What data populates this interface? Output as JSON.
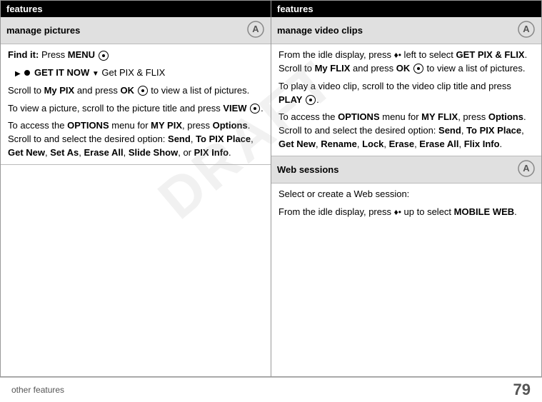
{
  "columns": [
    {
      "header": "features",
      "sections": [
        {
          "title": "manage pictures",
          "hasIcon": true,
          "content": [
            {
              "type": "find-it",
              "text_label": "Find it:",
              "text_main": "Press",
              "bold_key": "MENU",
              "nav_symbol": "(⬤)"
            },
            {
              "type": "get-it-now",
              "arrow": "▶",
              "icon": "◉",
              "bold_text": "GET IT NOW",
              "dropdown": "▼",
              "after": "Get PIX & FLIX"
            },
            {
              "type": "paragraph",
              "text": "Scroll to My PIX and press OK (⬤) to view a list of pictures."
            },
            {
              "type": "paragraph",
              "text": "To view a picture, scroll to the picture title and press VIEW (⬤)."
            },
            {
              "type": "paragraph",
              "text": "To access the OPTIONS menu for MY PIX, press Options. Scroll to and select the desired option: Send, To PIX Place, Get New, Set As, Erase All, Slide Show, or PIX Info."
            }
          ]
        }
      ]
    },
    {
      "header": "features",
      "sections": [
        {
          "title": "manage video clips",
          "hasIcon": true,
          "content": [
            {
              "type": "paragraph",
              "text": "From the idle display, press ⬤ left to select GET PIX & FLIX. Scroll to My FLIX and press OK (⬤) to view a list of pictures."
            },
            {
              "type": "paragraph",
              "text": "To play a video clip, scroll to the video clip title and press PLAY (⬤)."
            },
            {
              "type": "paragraph",
              "text": "To access the OPTIONS menu for MY FLIX, press Options. Scroll to and select the desired option: Send, To PIX Place, Get New, Rename, Lock, Erase, Erase All, Flix Info."
            }
          ]
        },
        {
          "title": "Web sessions",
          "hasIcon": true,
          "content": [
            {
              "type": "paragraph",
              "text": "Select or create a Web session:"
            },
            {
              "type": "paragraph",
              "text": "From the idle display, press ⬤ up to select MOBILE WEB."
            }
          ]
        }
      ]
    }
  ],
  "footer": {
    "left_text": "other features",
    "right_number": "79"
  },
  "watermark": "DRAFT"
}
